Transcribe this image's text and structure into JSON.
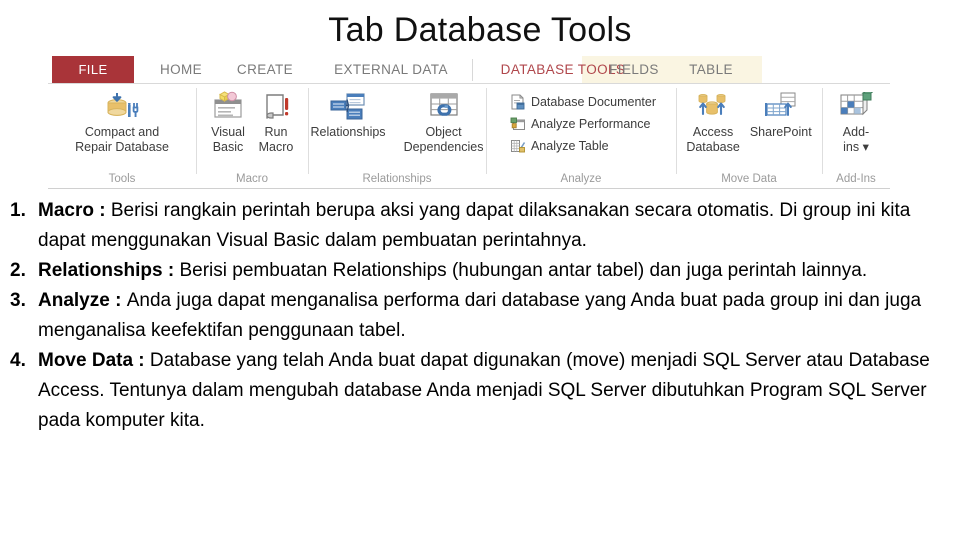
{
  "slide": {
    "title": "Tab Database Tools"
  },
  "ribbon": {
    "tabs": [
      {
        "id": "file",
        "label": "FILE"
      },
      {
        "id": "home",
        "label": "HOME"
      },
      {
        "id": "create",
        "label": "CREATE"
      },
      {
        "id": "external",
        "label": "EXTERNAL DATA"
      },
      {
        "id": "dbtools",
        "label": "DATABASE TOOLS"
      },
      {
        "id": "fields",
        "label": "FIELDS"
      },
      {
        "id": "table",
        "label": "TABLE"
      }
    ],
    "active_tab": "DATABASE TOOLS",
    "colors": {
      "file_tab_background": "#a93439",
      "active_tab_text": "#b0474c",
      "contextual_band": "#faf5e2",
      "tab_text": "#7a7a7a",
      "group_label": "#9b9b9b",
      "icon_gold": "#e8c06a",
      "icon_blue": "#4a7ebb",
      "icon_red": "#c0392b"
    },
    "groups": [
      {
        "label": "Tools",
        "items": [
          {
            "label": "Compact and\nRepair Database",
            "icon": "compact-repair-database-icon",
            "size": "big"
          }
        ]
      },
      {
        "label": "Macro",
        "items": [
          {
            "label": "Visual\nBasic",
            "icon": "visual-basic-icon",
            "size": "big"
          },
          {
            "label": "Run\nMacro",
            "icon": "run-macro-icon",
            "size": "big"
          }
        ]
      },
      {
        "label": "Relationships",
        "items": [
          {
            "label": "Relationships",
            "icon": "relationships-icon",
            "size": "big"
          },
          {
            "label": "Object\nDependencies",
            "icon": "object-dependencies-icon",
            "size": "big"
          }
        ]
      },
      {
        "label": "Analyze",
        "items": [
          {
            "label": "Database Documenter",
            "icon": "database-documenter-icon",
            "size": "small"
          },
          {
            "label": "Analyze Performance",
            "icon": "analyze-performance-icon",
            "size": "small"
          },
          {
            "label": "Analyze Table",
            "icon": "analyze-table-icon",
            "size": "small"
          }
        ]
      },
      {
        "label": "Move Data",
        "items": [
          {
            "label": "Access\nDatabase",
            "icon": "access-database-icon",
            "size": "big"
          },
          {
            "label": "SharePoint",
            "icon": "sharepoint-icon",
            "size": "big"
          }
        ]
      },
      {
        "label": "Add-Ins",
        "items": [
          {
            "label": "Add-\nins ▾",
            "icon": "add-ins-icon",
            "size": "big"
          }
        ]
      }
    ]
  },
  "content": {
    "items": [
      {
        "number": "1.",
        "term": "Macro",
        "separator": " : ",
        "body": "Berisi rangkain perintah berupa aksi yang dapat dilaksanakan secara otomatis. Di group ini kita dapat menggunakan Visual Basic dalam pembuatan perintahnya."
      },
      {
        "number": "2.",
        "term": "Relationships",
        "separator": " : ",
        "body": "Berisi pembuatan Relationships (hubungan antar tabel) dan juga perintah lainnya."
      },
      {
        "number": "3.",
        "term": "Analyze",
        "separator": " : ",
        "body": "Anda juga dapat menganalisa performa dari database yang Anda buat pada group ini dan juga menganalisa keefektifan penggunaan tabel."
      },
      {
        "number": "4.",
        "term": "Move Data",
        "separator": " : ",
        "body": "Database yang telah Anda buat dapat digunakan (move) menjadi SQL Server atau Database Access. Tentunya dalam mengubah database Anda menjadi SQL Server dibutuhkan Program SQL Server pada komputer kita."
      }
    ]
  }
}
